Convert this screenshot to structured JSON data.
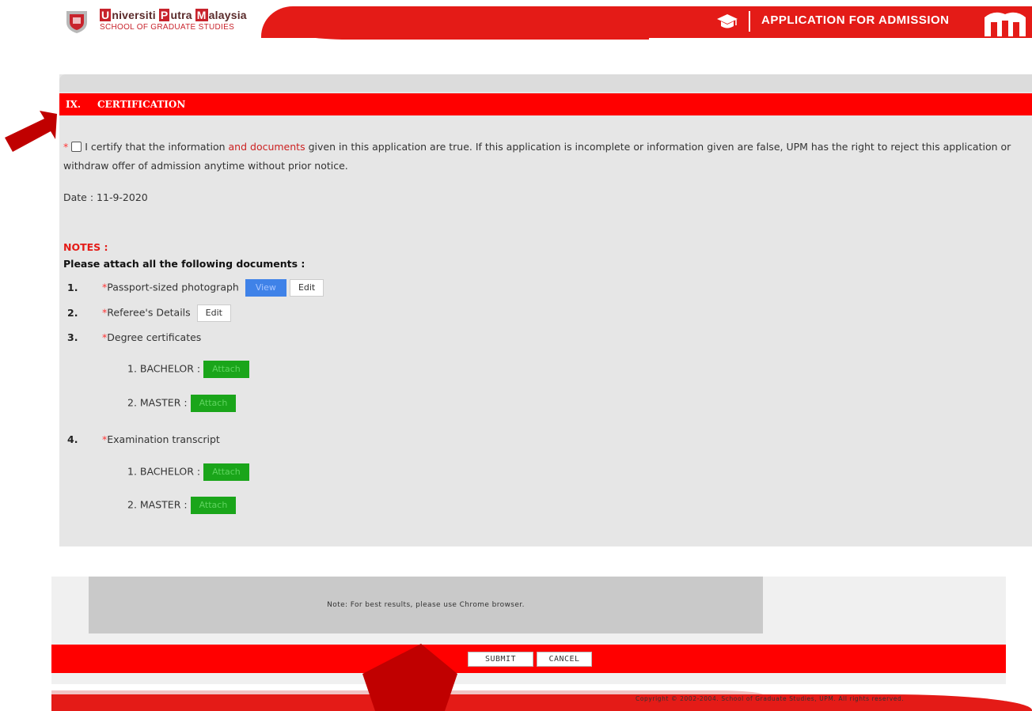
{
  "header": {
    "logo_first_letter_1": "U",
    "logo_word_1": "niversiti",
    "logo_first_letter_2": "P",
    "logo_word_2": "utra",
    "logo_first_letter_3": "M",
    "logo_word_3": "alaysia",
    "logo_subtitle": "SCHOOL OF GRADUATE STUDIES",
    "title": "APPLICATION FOR ADMISSION"
  },
  "section": {
    "number": "IX.",
    "title": "CERTIFICATION"
  },
  "certification": {
    "required_mark": "*",
    "text_before": "I certify that the information",
    "text_highlight": "and documents",
    "text_after": "given in this application are true. If this application is incomplete or information given are false, UPM has the right to reject this application or withdraw offer of admission anytime without prior notice.",
    "checked": false
  },
  "date": {
    "label": "Date :",
    "value": "11-9-2020"
  },
  "notes": {
    "title": "NOTES :",
    "subtitle": "Please attach all the following documents :",
    "items": [
      {
        "num": "1.",
        "req": "*",
        "label": "Passport-sized photograph",
        "view_label": "View",
        "edit_label": "Edit"
      },
      {
        "num": "2.",
        "req": "*",
        "label": "Referee's Details",
        "edit_label": "Edit"
      },
      {
        "num": "3.",
        "req": "*",
        "label": "Degree certificates",
        "subitems": [
          {
            "label": "1. BACHELOR :",
            "button": "Attach"
          },
          {
            "label": "2. MASTER :",
            "button": "Attach"
          }
        ]
      },
      {
        "num": "4.",
        "req": "*",
        "label": "Examination transcript",
        "subitems": [
          {
            "label": "1. BACHELOR :",
            "button": "Attach"
          },
          {
            "label": "2. MASTER :",
            "button": "Attach"
          }
        ]
      }
    ]
  },
  "footer": {
    "browser_note": "Note: For best results, please use Chrome browser.",
    "submit_label": "SUBMIT",
    "cancel_label": "CANCEL",
    "copyright": "Copyright © 2002-2004. School of Graduate Studies, UPM. All rights reserved."
  },
  "colors": {
    "brand_red": "#e41b17",
    "section_red": "#ff0000",
    "view_blue": "#3f82e8",
    "attach_green": "#1aa51a",
    "panel_gray": "#e6e6e6",
    "arrow_red": "#c00000"
  }
}
